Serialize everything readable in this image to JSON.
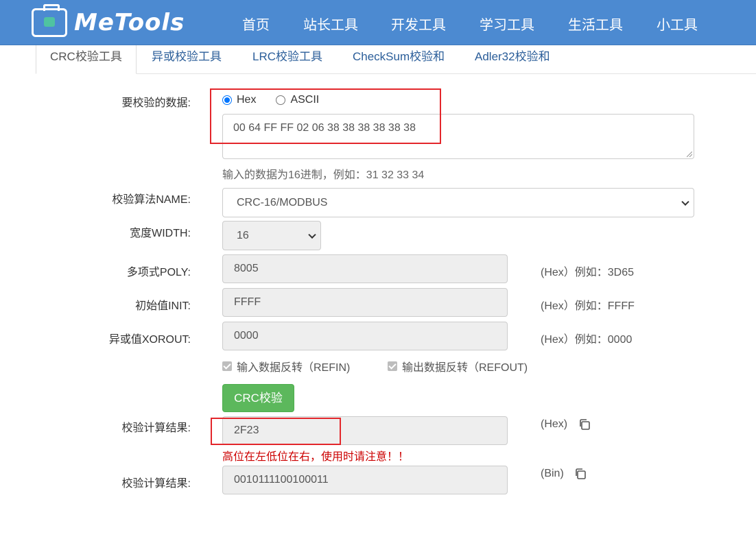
{
  "header": {
    "logo_text": "MeTools",
    "nav": [
      "首页",
      "站长工具",
      "开发工具",
      "学习工具",
      "生活工具",
      "小工具"
    ]
  },
  "tabs": [
    "CRC校验工具",
    "异或校验工具",
    "LRC校验工具",
    "CheckSum校验和",
    "Adler32校验和"
  ],
  "form": {
    "data_label": "要校验的数据:",
    "radio_hex": "Hex",
    "radio_ascii": "ASCII",
    "selected_mode": "Hex",
    "data_value": "00 64 FF FF 02 06 38 38 38 38 38 38",
    "data_help": "输入的数据为16进制，例如：31 32 33 34",
    "algo_label": "校验算法NAME:",
    "algo_value": "CRC-16/MODBUS",
    "width_label": "宽度WIDTH:",
    "width_value": "16",
    "poly_label": "多项式POLY:",
    "poly_value": "8005",
    "poly_hint": "(Hex）例如：3D65",
    "init_label": "初始值INIT:",
    "init_value": "FFFF",
    "init_hint": "(Hex）例如：FFFF",
    "xorout_label": "异或值XOROUT:",
    "xorout_value": "0000",
    "xorout_hint": "(Hex）例如：0000",
    "refin_label": "输入数据反转（REFIN)",
    "refout_label": "输出数据反转（REFOUT)",
    "button_label": "CRC校验",
    "result_label": "校验计算结果:",
    "result_hex": "2F23",
    "result_hex_hint": "(Hex)",
    "warning": "高位在左低位在右，使用时请注意！！",
    "result_bin_label": "校验计算结果:",
    "result_bin": "0010111100100011",
    "result_bin_hint": "(Bin)"
  }
}
